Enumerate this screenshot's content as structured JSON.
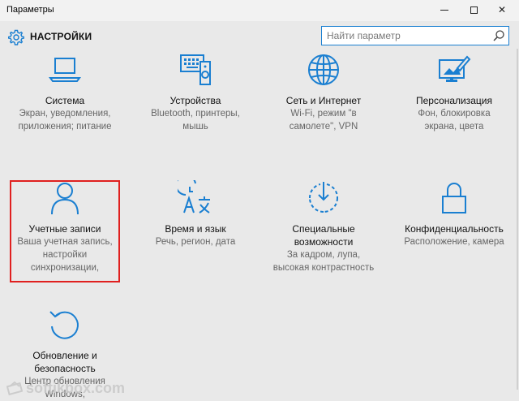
{
  "window": {
    "title": "Параметры",
    "minimize_icon": "minimize-icon",
    "maximize_icon": "maximize-icon",
    "close_glyph": "✕"
  },
  "header": {
    "title": "НАСТРОЙКИ",
    "icon": "gear-icon"
  },
  "search": {
    "placeholder": "Найти параметр",
    "icon": "search-icon"
  },
  "accent_color": "#1a7fd1",
  "highlight_color": "#e0201f",
  "tiles": [
    {
      "name": "Система",
      "desc": [
        "Экран, уведомления,",
        "приложения; питание"
      ],
      "icon": "laptop-icon"
    },
    {
      "name": "Устройства",
      "desc": [
        "Bluetooth, принтеры,",
        "мышь"
      ],
      "icon": "devices-icon"
    },
    {
      "name": "Сеть и Интернет",
      "desc": [
        "Wi-Fi, режим \"в",
        "самолете\", VPN"
      ],
      "icon": "globe-icon"
    },
    {
      "name": "Персонализация",
      "desc": [
        "Фон, блокировка",
        "экрана, цвета"
      ],
      "icon": "personalization-icon"
    },
    {
      "name": "Учетные записи",
      "desc": [
        "Ваша учетная запись,",
        "настройки",
        "синхронизации,"
      ],
      "icon": "person-icon"
    },
    {
      "name": "Время и язык",
      "desc": [
        "Речь, регион, дата"
      ],
      "icon": "time-language-icon"
    },
    {
      "name": "Специальные возможности",
      "name_lines": [
        "Специальные",
        "возможности"
      ],
      "desc": [
        "За кадром, лупа,",
        "высокая контрастность"
      ],
      "icon": "accessibility-icon"
    },
    {
      "name": "Конфиденциальность",
      "desc": [
        "Расположение, камера"
      ],
      "icon": "lock-icon"
    },
    {
      "name": "Обновление и безопасность",
      "name_lines": [
        "Обновление и",
        "безопасность"
      ],
      "desc": [
        "Центр обновления",
        "Windows,"
      ],
      "icon": "update-icon"
    }
  ],
  "watermark": {
    "text": "softikbox.com"
  }
}
